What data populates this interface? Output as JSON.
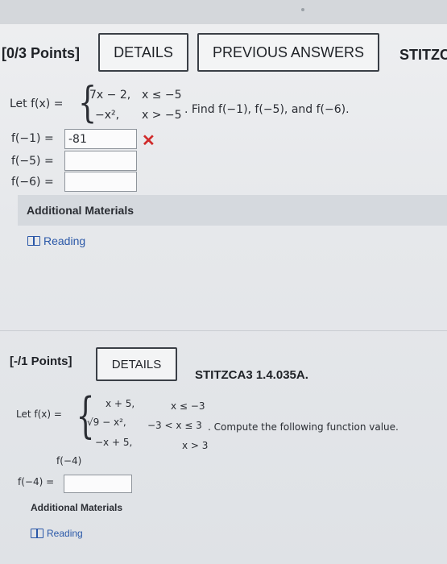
{
  "q1": {
    "points": "[0/3 Points]",
    "details": "DETAILS",
    "previous": "PREVIOUS ANSWERS",
    "code": "STITZC",
    "let": "Let f(x) =",
    "case1_expr": "7x − 2,",
    "case1_cond": "x ≤ −5",
    "case2_expr": "−x²,",
    "case2_cond": "x > −5",
    "prompt": ". Find f(−1), f(−5), and f(−6).",
    "answers": [
      {
        "label": "f(−1)  =",
        "value": "-81",
        "status": "incorrect"
      },
      {
        "label": "f(−5)  =",
        "value": ""
      },
      {
        "label": "f(−6)  =",
        "value": ""
      }
    ],
    "additional": "Additional Materials",
    "reading": "Reading"
  },
  "q2": {
    "points": "[-/1 Points]",
    "details": "DETAILS",
    "code": "STITZCA3 1.4.035A.",
    "let": "Let f(x) =",
    "case1_expr": "x + 5,",
    "case1_cond": "x ≤ −3",
    "case2_expr": "√9 − x²,",
    "case2_cond": "−3 < x ≤ 3",
    "case3_expr": "−x + 5,",
    "case3_cond": "x > 3",
    "prompt": ". Compute the following function value.",
    "sub_label": "f(−4)",
    "answer_label": "f(−4)  =",
    "answer_value": "",
    "additional": "Additional Materials",
    "reading": "Reading"
  },
  "colors": {
    "incorrect": "#d02b2b",
    "link": "#2b58a8"
  }
}
